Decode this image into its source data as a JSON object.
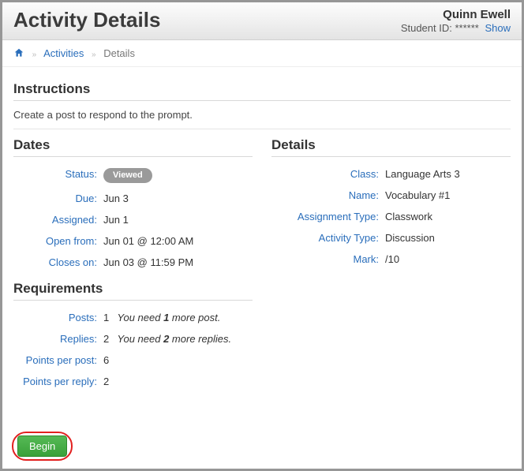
{
  "header": {
    "title": "Activity Details",
    "user_name": "Quinn Ewell",
    "student_id_label": "Student ID:",
    "student_id_masked": "******",
    "show_link": "Show"
  },
  "breadcrumb": {
    "activities": "Activities",
    "details": "Details"
  },
  "instructions": {
    "heading": "Instructions",
    "text": "Create a post to respond to the prompt."
  },
  "dates": {
    "heading": "Dates",
    "status_label": "Status:",
    "status_value": "Viewed",
    "due_label": "Due:",
    "due_value": "Jun 3",
    "assigned_label": "Assigned:",
    "assigned_value": "Jun 1",
    "open_label": "Open from:",
    "open_value": "Jun 01 @ 12:00 AM",
    "closes_label": "Closes on:",
    "closes_value": "Jun 03 @ 11:59 PM"
  },
  "details": {
    "heading": "Details",
    "class_label": "Class:",
    "class_value": "Language Arts 3",
    "name_label": "Name:",
    "name_value": "Vocabulary #1",
    "type_label": "Assignment Type:",
    "type_value": "Classwork",
    "activity_type_label": "Activity Type:",
    "activity_type_value": "Discussion",
    "mark_label": "Mark:",
    "mark_value": "/10"
  },
  "requirements": {
    "heading": "Requirements",
    "posts_label": "Posts:",
    "posts_value": "1",
    "posts_need_pre": "You need ",
    "posts_need_n": "1",
    "posts_need_post": " more post.",
    "replies_label": "Replies:",
    "replies_value": "2",
    "replies_need_pre": "You need ",
    "replies_need_n": "2",
    "replies_need_post": " more replies.",
    "ppp_label": "Points per post:",
    "ppp_value": "6",
    "ppr_label": "Points per reply:",
    "ppr_value": "2"
  },
  "actions": {
    "begin": "Begin"
  }
}
